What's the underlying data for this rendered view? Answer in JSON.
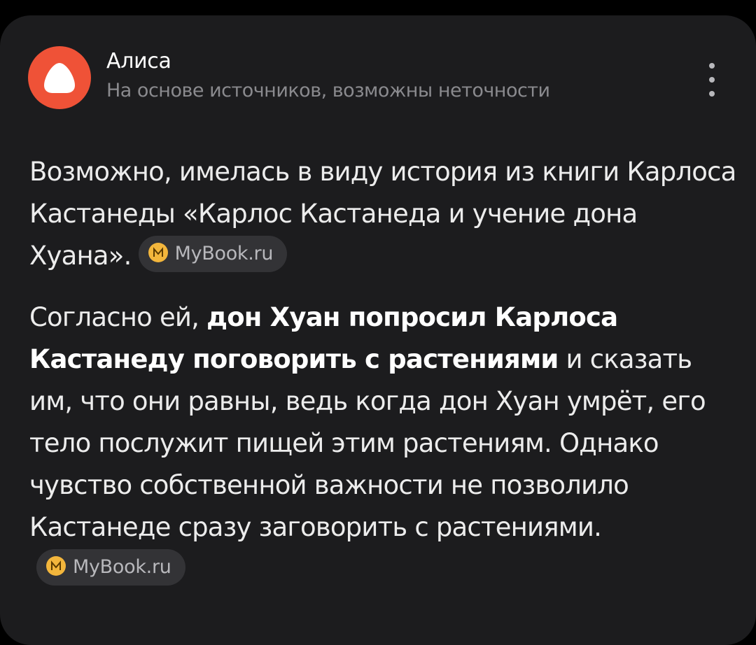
{
  "header": {
    "assistant_name": "Алиса",
    "disclaimer": "На основе источников, возможны неточности",
    "avatar_icon": "alice-logo-icon",
    "menu_icon": "more-vertical-icon"
  },
  "answer": {
    "paragraph1": {
      "text": "Возможно, имелась в виду история из книги Карлоса Кастанеды «Карлос Кастанеда и учение дона Хуана».",
      "source_label": "MyBook.ru"
    },
    "paragraph2": {
      "text_before": "Согласно ей, ",
      "bold": "дон Хуан попросил Карлоса Кастанеду поговорить с растениями",
      "text_after": " и сказать им, что они равны, ведь когда дон Хуан умрёт, его тело послужит пищей этим растениям. Однако чувство собственной важности не позволило Кастанеде сразу заговорить с растениями.",
      "source_label": "MyBook.ru"
    }
  },
  "colors": {
    "background": "#000000",
    "card": "#1c1c1e",
    "avatar": "#ef5237",
    "source_chip": "#333336",
    "source_icon": "#f3b63c"
  }
}
